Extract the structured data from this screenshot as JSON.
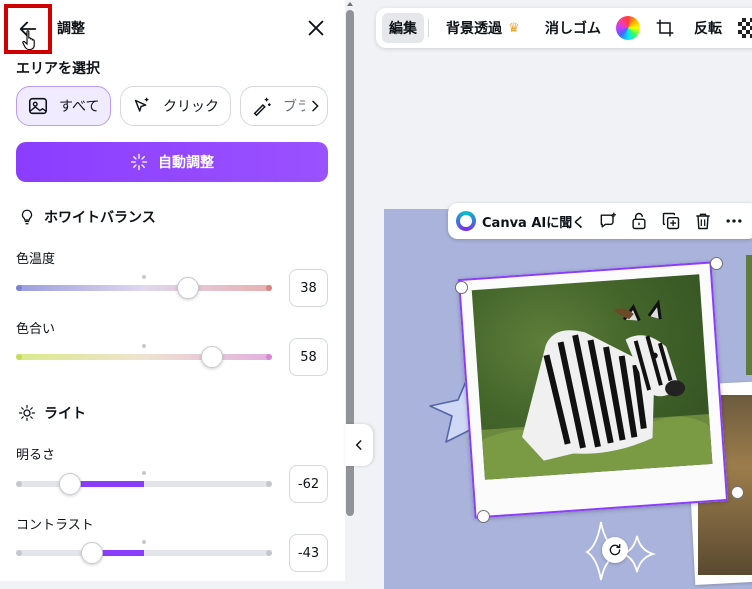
{
  "panel": {
    "title": "調整",
    "area_section": "エリアを選択",
    "area_buttons": [
      {
        "label": "すべて",
        "selected": true
      },
      {
        "label": "クリック",
        "selected": false
      },
      {
        "label": "ブラシ",
        "selected": false
      }
    ],
    "auto_adjust_label": "自動調整",
    "white_balance": {
      "title": "ホワイトバランス",
      "sliders": [
        {
          "label": "色温度",
          "value": "38",
          "level": 0.69
        },
        {
          "label": "色合い",
          "value": "58",
          "level": 0.79
        }
      ]
    },
    "light": {
      "title": "ライト",
      "sliders": [
        {
          "label": "明るさ",
          "value": "-62",
          "level": 0.19
        },
        {
          "label": "コントラスト",
          "value": "-43",
          "level": 0.28
        }
      ]
    }
  },
  "toolbar": {
    "edit_label": "編集",
    "bg_remove_label": "背景透過",
    "eraser_label": "消しゴム",
    "flip_label": "反転"
  },
  "ai_bar": {
    "label": "Canva AIに聞く"
  },
  "colors": {
    "accent": "#8b3dff",
    "highlight_box": "#d10000",
    "artboard": "#a9b3db"
  }
}
